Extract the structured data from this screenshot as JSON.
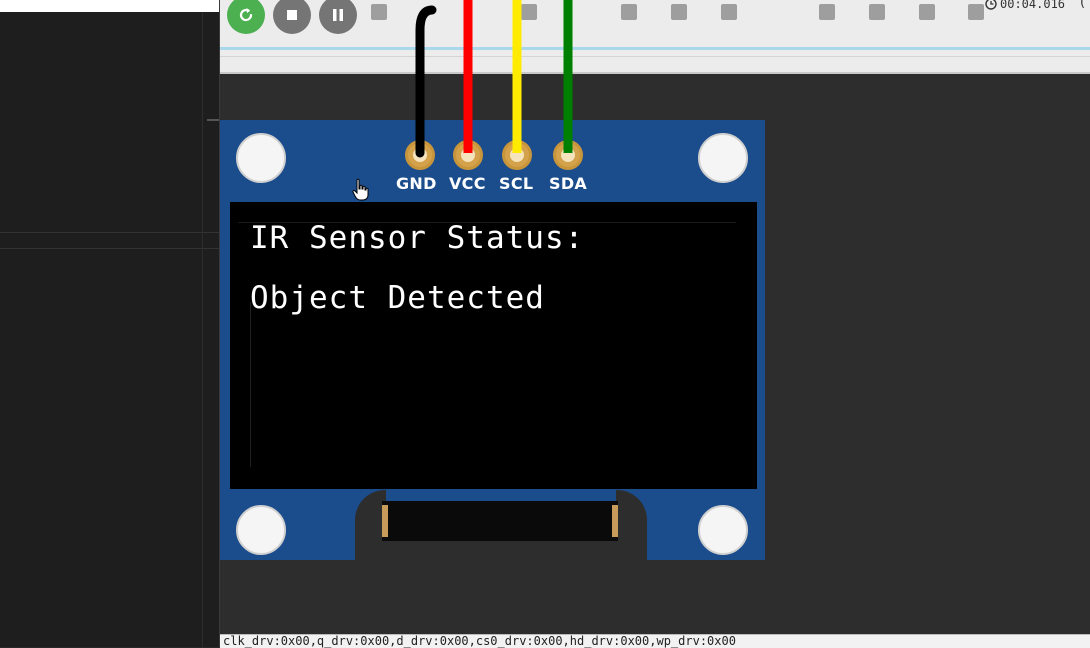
{
  "toolbar": {
    "restart_icon": "restart-icon",
    "stop_icon": "stop-icon",
    "pause_icon": "pause-icon",
    "restart_color": "#4caf50",
    "stop_color": "#757575",
    "pause_color": "#757575"
  },
  "timer": {
    "icon": "clock-icon",
    "value": "00:04.016",
    "extra": "("
  },
  "oled": {
    "pins": [
      "GND",
      "VCC",
      "SCL",
      "SDA"
    ],
    "screen_lines": [
      "IR Sensor Status:",
      "Object Detected"
    ],
    "board_color": "#1b4d8c"
  },
  "wires": {
    "colors": [
      "#000000",
      "#ff0000",
      "#ffeb00",
      "#008000"
    ]
  },
  "status_bar": {
    "text": "clk_drv:0x00,q_drv:0x00,d_drv:0x00,cs0_drv:0x00,hd_drv:0x00,wp_drv:0x00"
  }
}
